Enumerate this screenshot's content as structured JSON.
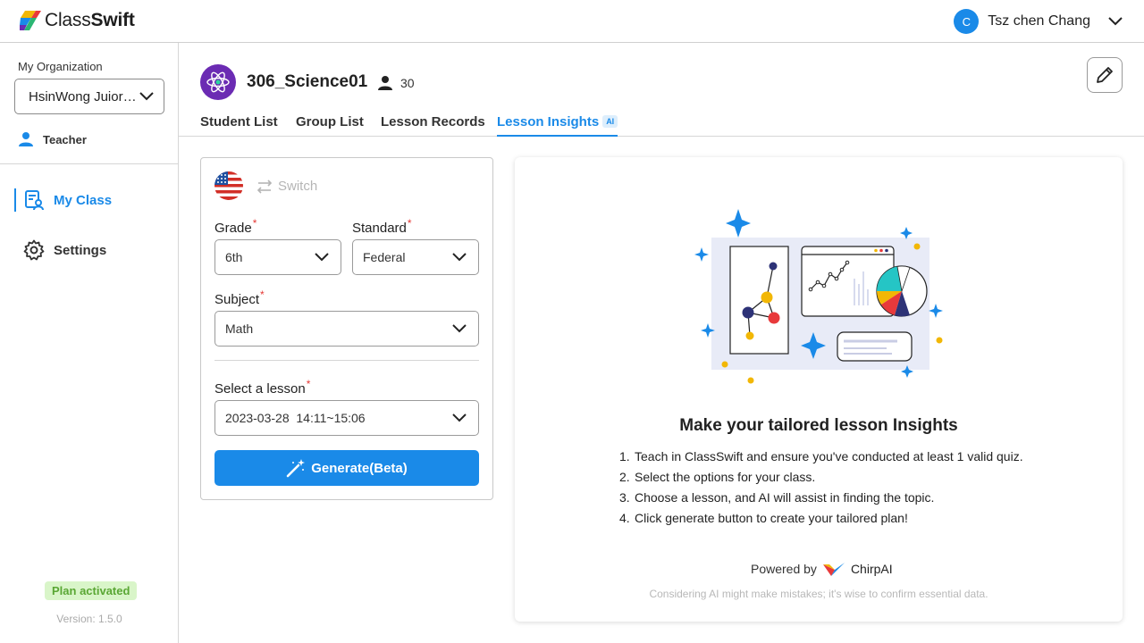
{
  "app": {
    "logo_text_light": "Class",
    "logo_text_bold": "Swift"
  },
  "user": {
    "initial": "C",
    "name": "Tsz chen Chang"
  },
  "sidebar": {
    "org_label": "My Organization",
    "org_value": "HsinWong Juior High...",
    "role": "Teacher",
    "nav": [
      {
        "label": "My Class",
        "icon": "class-icon",
        "active": true
      },
      {
        "label": "Settings",
        "icon": "gear-icon",
        "active": false
      }
    ],
    "plan_status": "Plan activated",
    "version": "Version: 1.5.0"
  },
  "class_header": {
    "name": "306_Science01",
    "member_count": "30"
  },
  "tabs": [
    {
      "label": "Student List"
    },
    {
      "label": "Group List"
    },
    {
      "label": "Lesson Records"
    },
    {
      "label": "Lesson Insights",
      "badge": "AI",
      "active": true
    }
  ],
  "form": {
    "switch_label": "Switch",
    "grade_label": "Grade",
    "grade_value": "6th",
    "standard_label": "Standard",
    "standard_value": "Federal",
    "subject_label": "Subject",
    "subject_value": "Math",
    "lesson_label": "Select a lesson",
    "lesson_value": "2023-03-28  14:11~15:06",
    "generate_label": "Generate(Beta)"
  },
  "insights_card": {
    "title": "Make your tailored lesson Insights",
    "steps": [
      "Teach in ClassSwift and ensure you've conducted at least 1 valid quiz.",
      "Select the options for your class.",
      "Choose a lesson, and AI will assist in finding the topic.",
      "Click generate button to create your tailored plan!"
    ],
    "powered_by": "Powered by",
    "powered_brand": "ChirpAI",
    "disclaimer": "Considering AI might make mistakes; it's wise to confirm essential data."
  },
  "colors": {
    "accent": "#1a8ae8",
    "required": "#e53935",
    "plan_bg": "#d9f5c9",
    "plan_text": "#5aa734",
    "class_icon_bg": "#6b2bb3"
  }
}
